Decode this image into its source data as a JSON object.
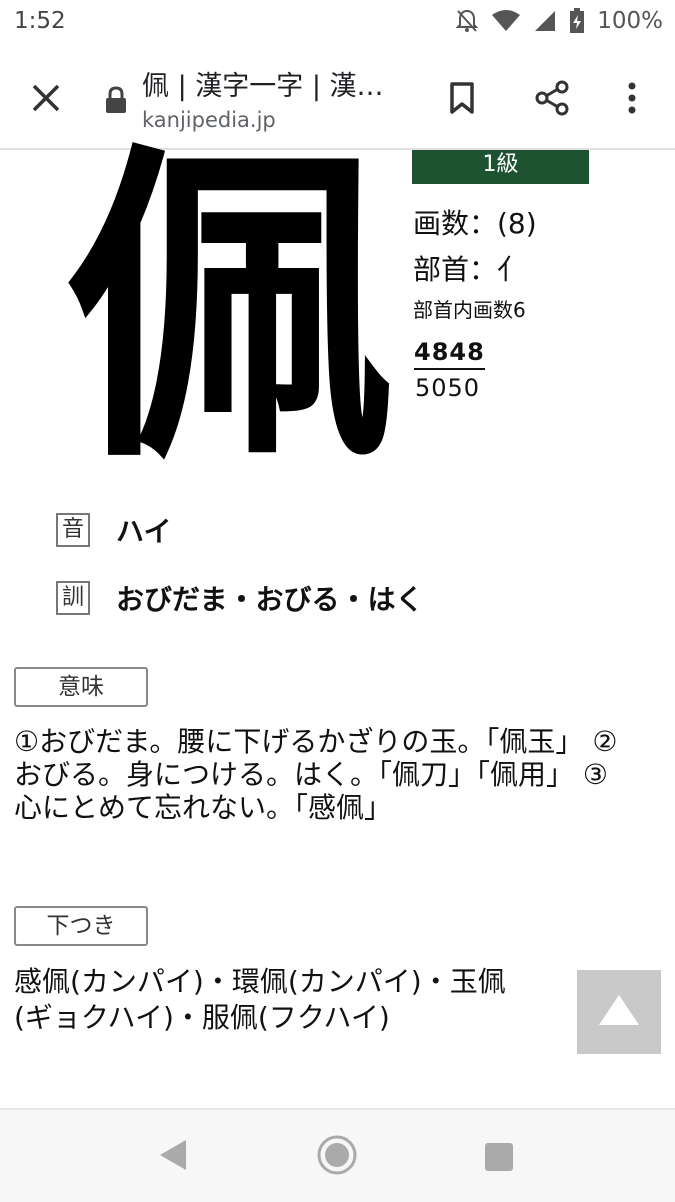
{
  "status_bar": {
    "time": "1:52",
    "battery": "100%",
    "icons": [
      "notifications-off-icon",
      "wifi-icon",
      "signal-icon",
      "battery-charging-icon"
    ]
  },
  "toolbar": {
    "title": "佩 | 漢字一字 | 漢…",
    "url": "kanjipedia.jp",
    "icons": [
      "close-icon",
      "lock-icon",
      "bookmark-icon",
      "share-icon",
      "more-vert-icon"
    ]
  },
  "kanji": {
    "character": "佩",
    "grade": "1級",
    "grade_color": "#1d5331",
    "strokes": "画数：(8)",
    "radical": "部首：亻",
    "radical_strokes": "部首内画数6",
    "code_top": "4848",
    "code_bottom": "5050"
  },
  "readings": {
    "on_tag": "音",
    "on_value": "ハイ",
    "kun_tag": "訓",
    "kun_value": "おびだま・おびる・はく"
  },
  "meaning": {
    "label": "意味",
    "text": "①おびだま。腰に下げるかざりの玉。「佩玉」 ②おびる。身につける。はく。「佩刀」「佩用」 ③心にとめて忘れない。「感佩」"
  },
  "shitatsuki": {
    "label": "下つき",
    "text": "感佩(カンパイ)・環佩(カンパイ)・玉佩\n(ギョクハイ)・服佩(フクハイ)"
  },
  "scroll_top_icon": "arrow-up-icon",
  "nav_bar": {
    "icons": [
      "back-icon",
      "home-icon",
      "recent-apps-icon"
    ]
  }
}
